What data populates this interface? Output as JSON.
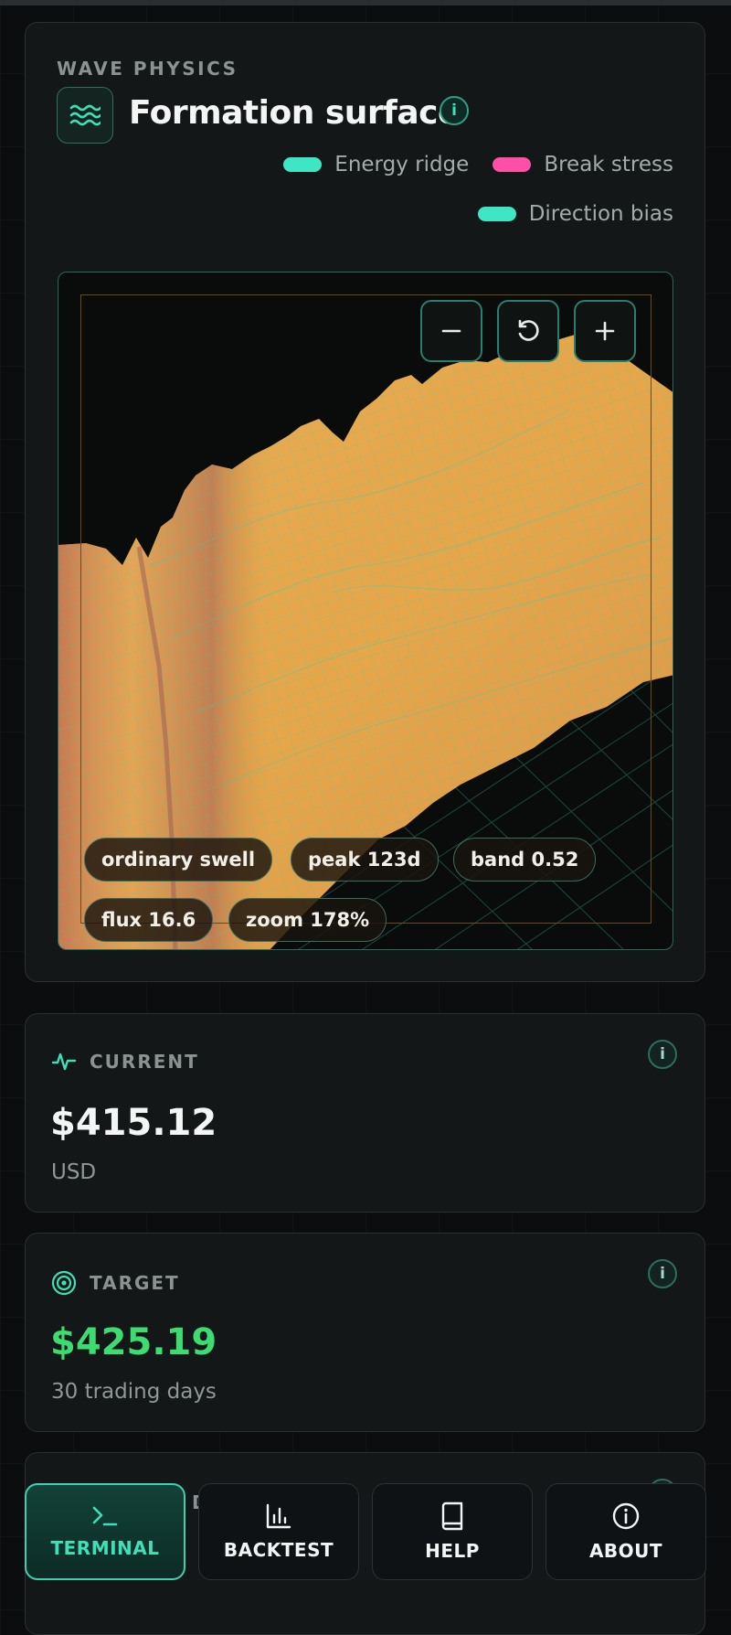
{
  "surface": {
    "eyebrow": "WAVE PHYSICS",
    "title": "Formation surface",
    "info_glyph": "i",
    "legend": [
      {
        "label": "Energy ridge",
        "color": "#3ee6c4"
      },
      {
        "label": "Break stress",
        "color": "#ff4fa7"
      },
      {
        "label": "Direction bias",
        "color": "#3ee6c4"
      }
    ],
    "chips": [
      "ordinary swell",
      "peak 123d",
      "band 0.52",
      "flux 16.6",
      "zoom 178%"
    ],
    "surface_color": "#e3a448",
    "mesh_color": "#35d2ae"
  },
  "current": {
    "label": "CURRENT",
    "value": "$415.12",
    "sub": "USD"
  },
  "target": {
    "label": "TARGET",
    "value": "$425.19",
    "sub": "30 trading days",
    "value_color": "#3ddc72"
  },
  "partial": {
    "label_fragment": "D"
  },
  "nav": {
    "items": [
      {
        "label": "TERMINAL",
        "icon": "terminal-icon",
        "active": true
      },
      {
        "label": "BACKTEST",
        "icon": "bar-chart-icon",
        "active": false
      },
      {
        "label": "HELP",
        "icon": "book-icon",
        "active": false
      },
      {
        "label": "ABOUT",
        "icon": "info-icon",
        "active": false
      }
    ]
  }
}
